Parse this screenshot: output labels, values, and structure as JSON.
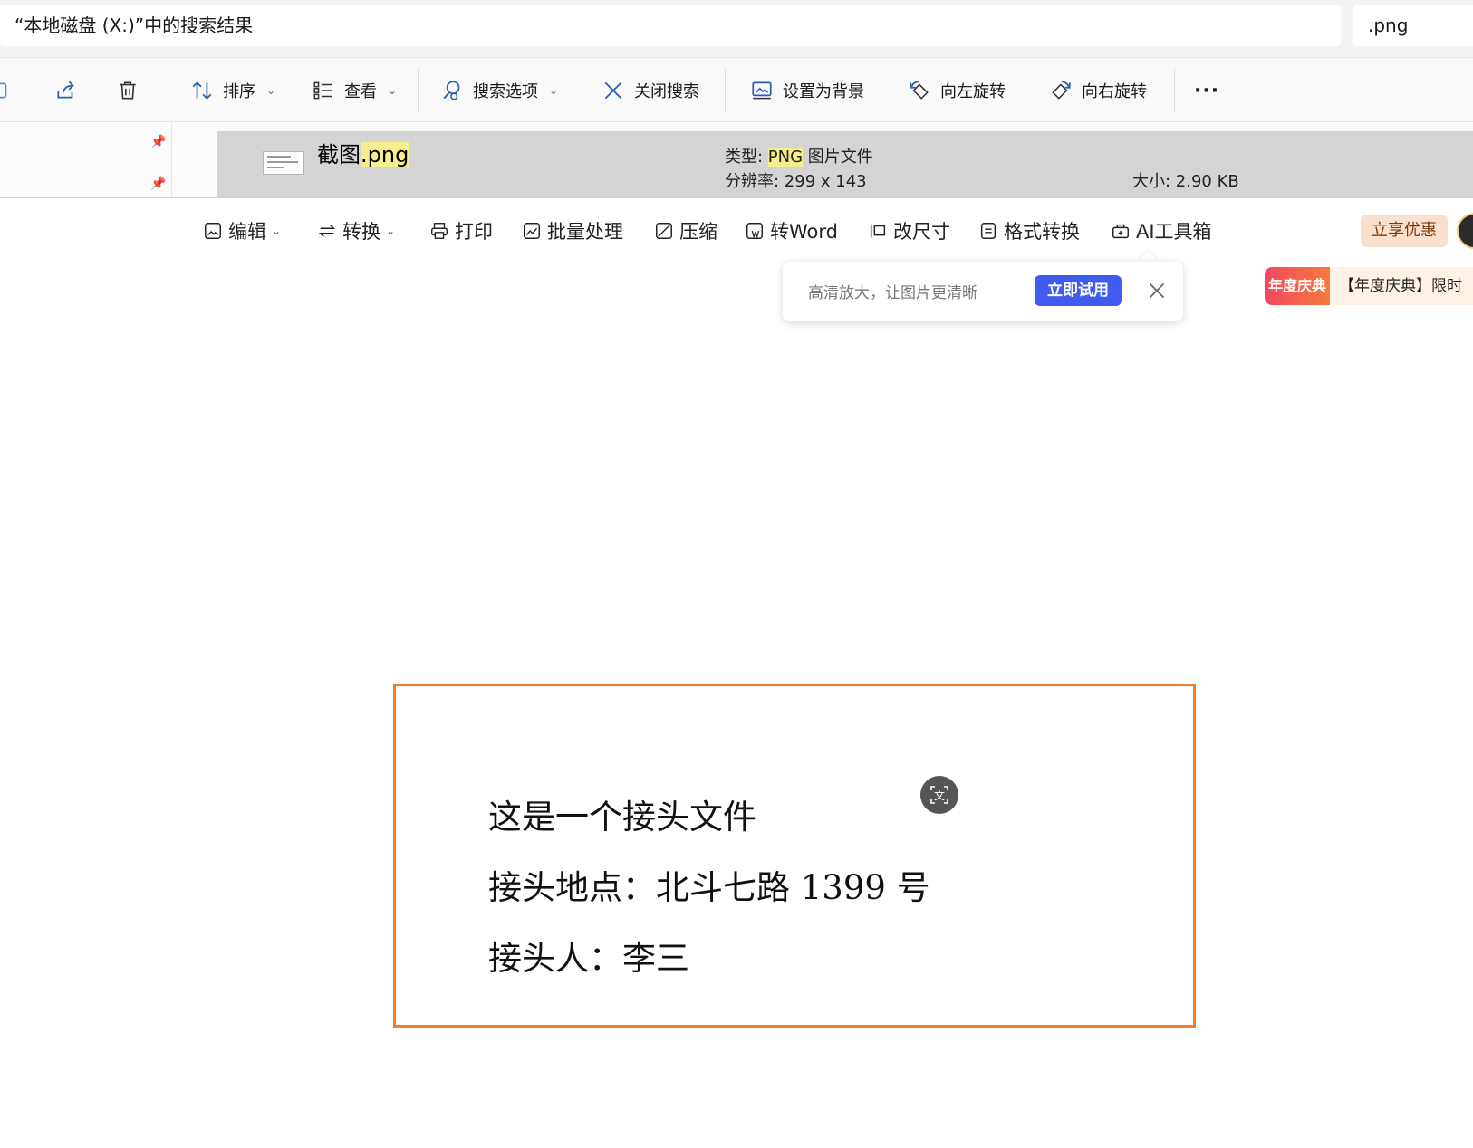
{
  "explorer": {
    "address": "“本地磁盘 (X:)”中的搜索结果",
    "search_value": ".png",
    "toolbar": {
      "sort": "排序",
      "view": "查看",
      "search_options": "搜索选项",
      "close_search": "关闭搜索",
      "set_background": "设置为背景",
      "rotate_left": "向左旋转",
      "rotate_right": "向右旋转",
      "more": "···"
    },
    "file": {
      "name_base": "截图",
      "name_ext": ".png",
      "type_label": "类型: ",
      "type_highlight": "PNG",
      "type_rest": " 图片文件",
      "resolution": "分辨率: 299 x 143",
      "size": "大小: 2.90 KB"
    }
  },
  "viewer": {
    "toolbar": {
      "edit": "编辑",
      "convert": "转换",
      "print": "打印",
      "batch": "批量处理",
      "compress": "压缩",
      "to_word": "转Word",
      "resize": "改尺寸",
      "format_convert": "格式转换",
      "ai_tools": "AI工具箱",
      "promo": "立享优惠"
    },
    "tip": {
      "text": "高清放大，让图片更清晰",
      "try_label": "立即试用"
    },
    "banner": {
      "tag": "年度庆典",
      "text": "【年度庆典】限时"
    },
    "document": {
      "lines": [
        "这是一个接头文件",
        "接头地点：北斗七路 1399 号",
        "接头人：李三"
      ]
    }
  },
  "colors": {
    "frame": "#f07f2c",
    "accent": "#3f5bf0",
    "highlight": "#f5ee8c"
  }
}
